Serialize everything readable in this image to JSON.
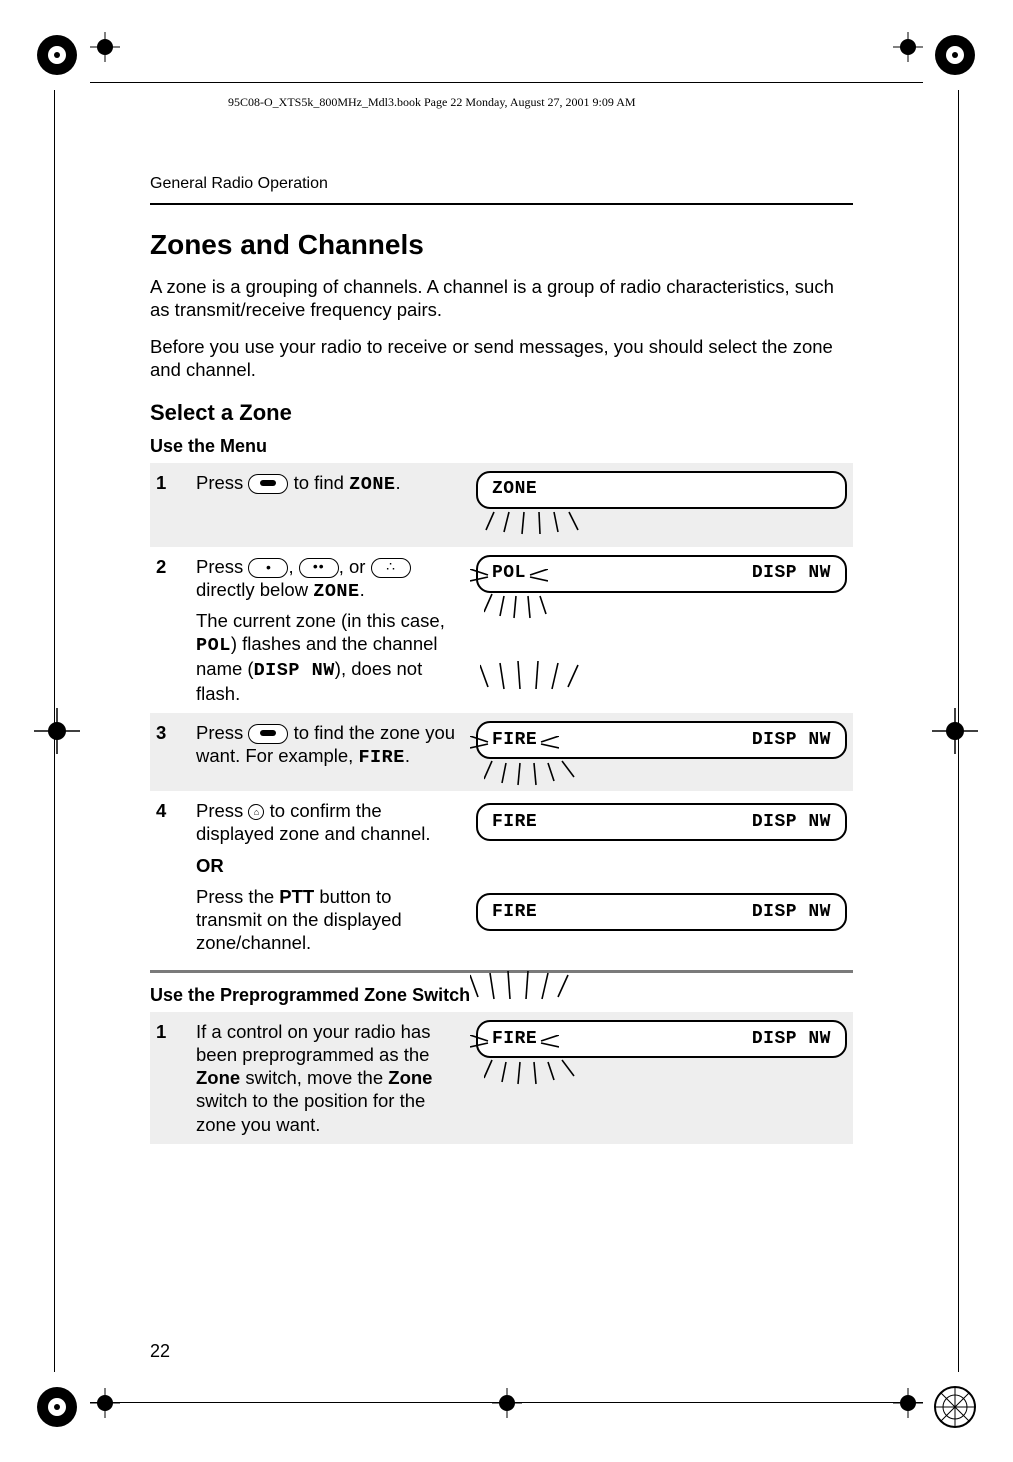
{
  "print_header": "95C08-O_XTS5k_800MHz_Mdl3.book  Page 22  Monday, August 27, 2001  9:09 AM",
  "running_head": "General Radio Operation",
  "page_number": "22",
  "section_title": "Zones and Channels",
  "intro_p1": "A zone is a grouping of channels. A channel is a group of radio characteristics, such as transmit/receive frequency pairs.",
  "intro_p2": "Before you use your radio to receive or send messages, you should select the zone and channel.",
  "select_zone_heading": "Select a Zone",
  "use_menu_heading": "Use the Menu",
  "steps_menu": {
    "s1_num": "1",
    "s1_pre": "Press ",
    "s1_post": " to find ",
    "s1_code": "ZONE",
    "s1_end": ".",
    "s2_num": "2",
    "s2_pre": "Press ",
    "s2_mid1": ", ",
    "s2_mid2": ", or ",
    "s2_post": " directly below ",
    "s2_code": "ZONE",
    "s2_end": ".",
    "s2_para2_a": "The current zone (in this case, ",
    "s2_para2_code1": "POL",
    "s2_para2_b": ") flashes and the channel name (",
    "s2_para2_code2": "DISP NW",
    "s2_para2_c": "), does not flash.",
    "s3_num": "3",
    "s3_pre": "Press ",
    "s3_mid": " to find the zone you want. For example, ",
    "s3_code": "FIRE",
    "s3_end": ".",
    "s4_num": "4",
    "s4_pre": "Press ",
    "s4_post": " to confirm the displayed zone and channel.",
    "or": "OR",
    "s4b_a": "Press the ",
    "s4b_bold": "PTT",
    "s4b_b": " button to transmit on the displayed zone/channel."
  },
  "use_switch_heading": "Use the Preprogrammed Zone Switch",
  "steps_switch": {
    "s1_num": "1",
    "s1_a": "If a control on your radio has been preprogrammed as the ",
    "s1_bold1": "Zone",
    "s1_b": " switch, move the ",
    "s1_bold2": "Zone",
    "s1_c": " switch to the position for the zone you want."
  },
  "lcd": {
    "zone_left": "ZONE",
    "pol_left": "POL",
    "fire_left": "FIRE",
    "right": "DISP NW"
  },
  "icons": {
    "scroll_key": "scroll-key-icon",
    "one_dot_key": "one-dot-key-icon",
    "two_dot_key": "two-dot-key-icon",
    "three_dot_key": "three-dot-key-icon",
    "home_key": "home-key-icon",
    "registration_mark": "registration-mark-icon",
    "crosshair": "crosshair-icon"
  }
}
